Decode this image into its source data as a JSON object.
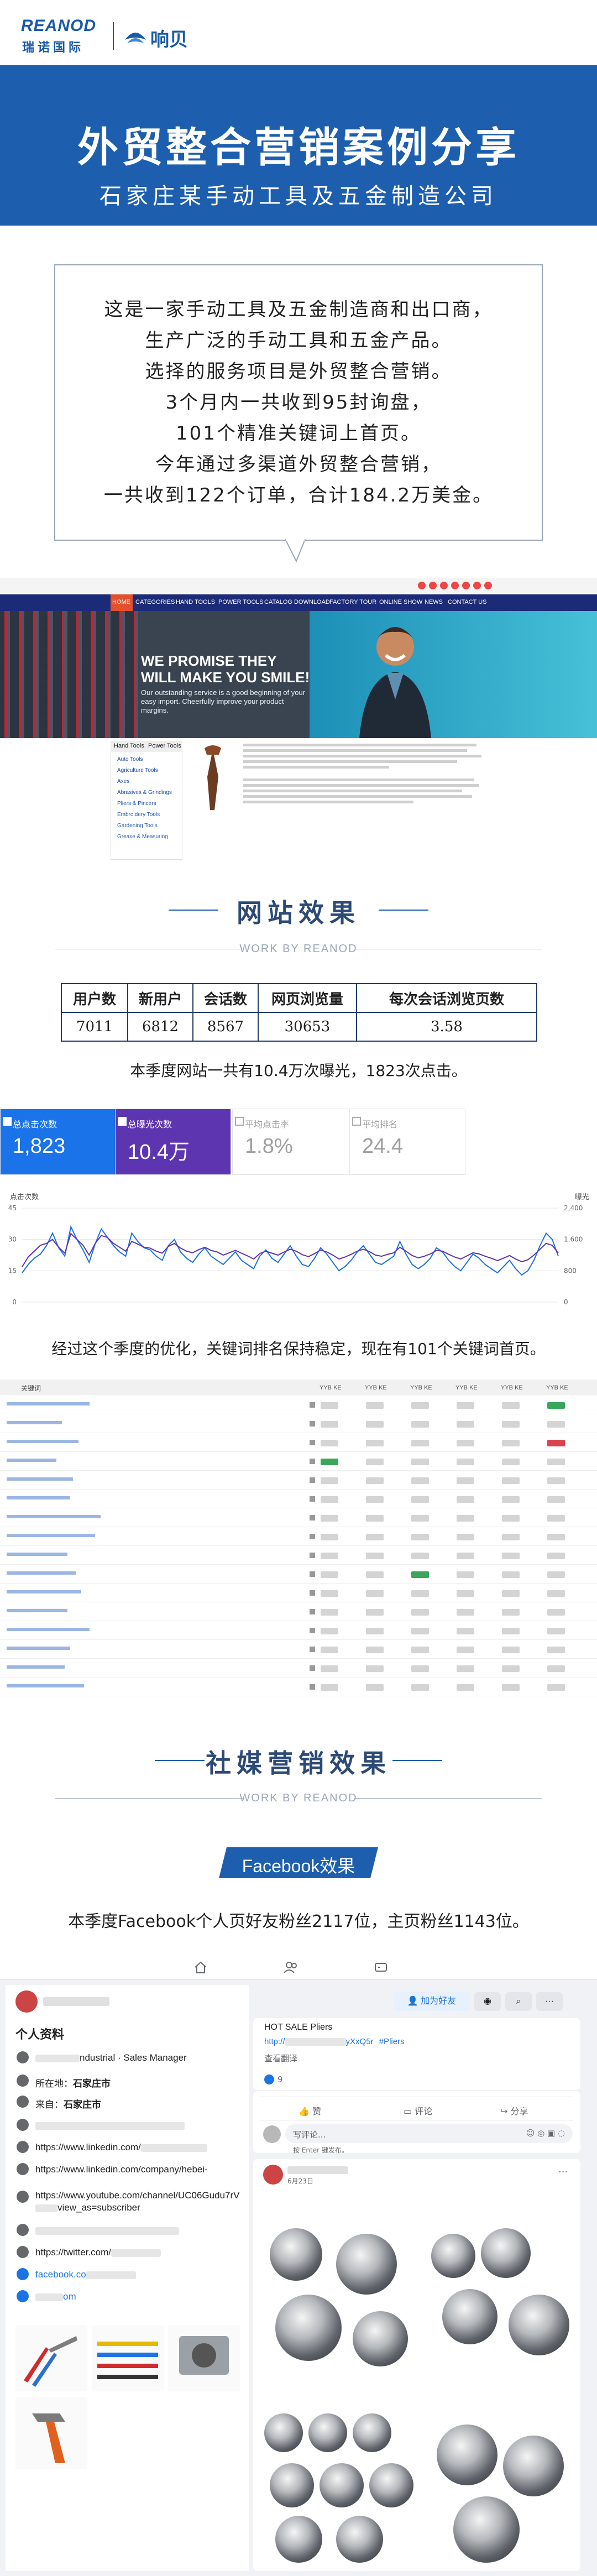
{
  "header": {
    "logo_reanod": "REANOD",
    "logo_reanod_cn": "瑞诺国际",
    "logo_xiangbei": "响贝"
  },
  "banner": {
    "title": "外贸整合营销案例分享",
    "subtitle": "石家庄某手动工具及五金制造公司"
  },
  "intro": {
    "lines": [
      "这是一家手动工具及五金制造商和出口商，",
      "生产广泛的手动工具和五金产品。",
      "选择的服务项目是外贸整合营销。",
      "3个月内一共收到95封询盘，",
      "101个精准关键词上首页。",
      "今年通过多渠道外贸整合营销，",
      "一共收到122个订单，合计184.2万美金。"
    ]
  },
  "website": {
    "nav": [
      "HOME",
      "CATEGORIES",
      "HAND TOOLS",
      "POWER TOOLS",
      "CATALOG DOWNLOAD",
      "FACTORY TOUR",
      "ONLINE SHOW",
      "NEWS",
      "CONTACT US"
    ],
    "hero_title_1": "WE PROMISE THEY",
    "hero_title_2": "WILL MAKE YOU SMILE!",
    "hero_text": "Our outstanding service is a good beginning of your easy import. Cheerfully improve your product margins.",
    "product_tabs": [
      "Hand Tools",
      "Power Tools"
    ],
    "product_items": [
      "Auto Tools",
      "Agriculture Tools",
      "Axes",
      "Abrasives & Grindings",
      "Pliers & Pincers",
      "Embroidery Tools",
      "Gardening Tools",
      "Grease & Measuring"
    ]
  },
  "site_effect": {
    "title": "网站效果",
    "subtitle": "WORK BY REANOD",
    "table_headers": [
      "用户数",
      "新用户",
      "会话数",
      "网页浏览量",
      "每次会话浏览页数"
    ],
    "table_values": [
      "7011",
      "6812",
      "8567",
      "30653",
      "3.58"
    ],
    "caption": "本季度网站一共有10.4万次曝光，1823次点击。"
  },
  "analytics": {
    "cards": [
      {
        "label": "总点击次数",
        "value": "1,823",
        "bg": "#1a73e8",
        "fg": "#ffffff"
      },
      {
        "label": "总曝光次数",
        "value": "10.4万",
        "bg": "#5e35b1",
        "fg": "#ffffff"
      },
      {
        "label": "平均点击率",
        "value": "1.8%",
        "bg": "#ffffff",
        "fg": "#9e9e9e"
      },
      {
        "label": "平均排名",
        "value": "24.4",
        "bg": "#ffffff",
        "fg": "#9e9e9e"
      }
    ],
    "chart_left_label": "点击次数",
    "chart_right_label": "曝光",
    "y_left_ticks": [
      "45",
      "30",
      "15",
      "0"
    ],
    "y_right_ticks": [
      "2,400",
      "1,600",
      "800",
      "0"
    ]
  },
  "chart_data": {
    "type": "line",
    "series": [
      {
        "name": "点击次数",
        "color": "#1a73e8",
        "axis": "left",
        "values": [
          14,
          18,
          21,
          23,
          27,
          33,
          26,
          22,
          36,
          30,
          25,
          19,
          28,
          35,
          31,
          27,
          24,
          22,
          33,
          29,
          26,
          25,
          22,
          20,
          27,
          30,
          24,
          21,
          19,
          23,
          26,
          22,
          20,
          18,
          21,
          24,
          20,
          18,
          16,
          22,
          25,
          21,
          19,
          23,
          27,
          22,
          18,
          17,
          21,
          26,
          23,
          19,
          15,
          17,
          20,
          24,
          27,
          23,
          19,
          18,
          20,
          22,
          29,
          23,
          18,
          16,
          18,
          21,
          26,
          24,
          20,
          17,
          15,
          19,
          23,
          21,
          18,
          16,
          14,
          17,
          20,
          16,
          13,
          15,
          20,
          27,
          33,
          30,
          22
        ]
      },
      {
        "name": "曝光",
        "color": "#5e35b1",
        "axis": "right",
        "values": [
          900,
          1150,
          1300,
          1450,
          1500,
          1600,
          1400,
          1250,
          1750,
          1600,
          1450,
          1200,
          1500,
          1700,
          1650,
          1500,
          1400,
          1300,
          1550,
          1480,
          1400,
          1380,
          1300,
          1250,
          1420,
          1500,
          1380,
          1300,
          1260,
          1340,
          1400,
          1320,
          1280,
          1200,
          1260,
          1320,
          1250,
          1180,
          1100,
          1240,
          1300,
          1250,
          1200,
          1280,
          1350,
          1300,
          1210,
          1160,
          1240,
          1330,
          1280,
          1200,
          1100,
          1150,
          1220,
          1300,
          1350,
          1290,
          1200,
          1170,
          1220,
          1260,
          1400,
          1300,
          1190,
          1130,
          1170,
          1230,
          1320,
          1300,
          1220,
          1150,
          1100,
          1180,
          1260,
          1230,
          1170,
          1120,
          1060,
          1120,
          1190,
          1100,
          1030,
          1080,
          1200,
          1350,
          1500,
          1450,
          1250
        ]
      }
    ],
    "ylim_left": [
      0,
      45
    ],
    "ylim_right": [
      0,
      2400
    ]
  },
  "keyword_caption": "经过这个季度的优化，关键词排名保持稳定，现在有101个关键词首页。",
  "keywords": {
    "head_label": "关键词",
    "col_heads": [
      "YYB KE",
      "YYB KE",
      "YYB KE",
      "YYB KE",
      "YYB KE",
      "YYB KE"
    ],
    "rows": [
      {
        "kw": "china hand tools wholesale",
        "w": 150,
        "cells": [
          "n",
          "n",
          "n",
          "n",
          "n",
          "g"
        ]
      },
      {
        "kw": "china hand tools",
        "w": 100,
        "cells": [
          "n",
          "n",
          "n",
          "n",
          "n",
          "n"
        ]
      },
      {
        "kw": "china shovel manufacturer",
        "w": 130,
        "cells": [
          "n",
          "n",
          "n",
          "n",
          "n",
          "r"
        ]
      },
      {
        "kw": "plier in china",
        "w": 90,
        "cells": [
          "g",
          "n",
          "n",
          "n",
          "n",
          "n"
        ]
      },
      {
        "kw": "china hammer factory",
        "w": 120,
        "cells": [
          "n",
          "n",
          "n",
          "n",
          "n",
          "n"
        ]
      },
      {
        "kw": "china tools wholesale",
        "w": 115,
        "cells": [
          "n",
          "n",
          "n",
          "n",
          "n",
          "n"
        ]
      },
      {
        "kw": "hand tools manufacturers in china",
        "w": 170,
        "cells": [
          "n",
          "n",
          "n",
          "n",
          "n",
          "n"
        ]
      },
      {
        "kw": "agriculture tools manufacturer",
        "w": 160,
        "cells": [
          "n",
          "n",
          "n",
          "n",
          "n",
          "n"
        ]
      },
      {
        "kw": "wholesale hand tools",
        "w": 110,
        "cells": [
          "n",
          "n",
          "n",
          "n",
          "n",
          "n"
        ]
      },
      {
        "kw": "rake products supplier",
        "w": 125,
        "cells": [
          "n",
          "n",
          "g",
          "n",
          "n",
          "n"
        ]
      },
      {
        "kw": "building tools supplier",
        "w": 135,
        "cells": [
          "n",
          "n",
          "n",
          "n",
          "n",
          "n"
        ]
      },
      {
        "kw": "china shovel factory",
        "w": 110,
        "cells": [
          "n",
          "n",
          "n",
          "n",
          "n",
          "n"
        ]
      },
      {
        "kw": "china hand tools manufacturer",
        "w": 150,
        "cells": [
          "n",
          "n",
          "n",
          "n",
          "n",
          "n"
        ]
      },
      {
        "kw": "china gardening tool",
        "w": 115,
        "cells": [
          "n",
          "n",
          "n",
          "n",
          "n",
          "n"
        ]
      },
      {
        "kw": "china tools supplier",
        "w": 105,
        "cells": [
          "n",
          "n",
          "n",
          "n",
          "n",
          "n"
        ]
      },
      {
        "kw": "china pliers manufacturer",
        "w": 140,
        "cells": [
          "n",
          "n",
          "n",
          "n",
          "n",
          "n"
        ]
      }
    ]
  },
  "social": {
    "title": "社媒营销效果",
    "subtitle": "WORK BY REANOD",
    "badge": "Facebook效果",
    "caption": "本季度Facebook个人页好友粉丝2117位，主页粉丝1143位。"
  },
  "facebook": {
    "add_friend": "加为好友",
    "profile_heading": "个人资料",
    "job_suffix": "ndustrial · Sales Manager",
    "lives_in_label": "所在地：",
    "lives_in_value": "石家庄市",
    "from_label": "来自：",
    "from_value": "石家庄市",
    "links": [
      "https://www.linkedin.com/",
      "https://www.linkedin.com/company/hebei-",
      "https://www.youtube.com/channel/UC06Gudu7rV",
      "view_as=subscriber",
      "https://twitter.com/",
      "facebook.co",
      "om"
    ],
    "post_text": "HOT SALE Pliers",
    "post_link": "http://",
    "post_link_tail": "yXxQ5r",
    "post_tag": "#Pliers",
    "see_translation": "查看翻译",
    "like_count": "9",
    "like_btn": "赞",
    "comment_btn": "评论",
    "share_btn": "分享",
    "comment_placeholder": "写评论...",
    "comment_hint": "按 Enter 键发布。",
    "post2_date": "6月23日"
  }
}
